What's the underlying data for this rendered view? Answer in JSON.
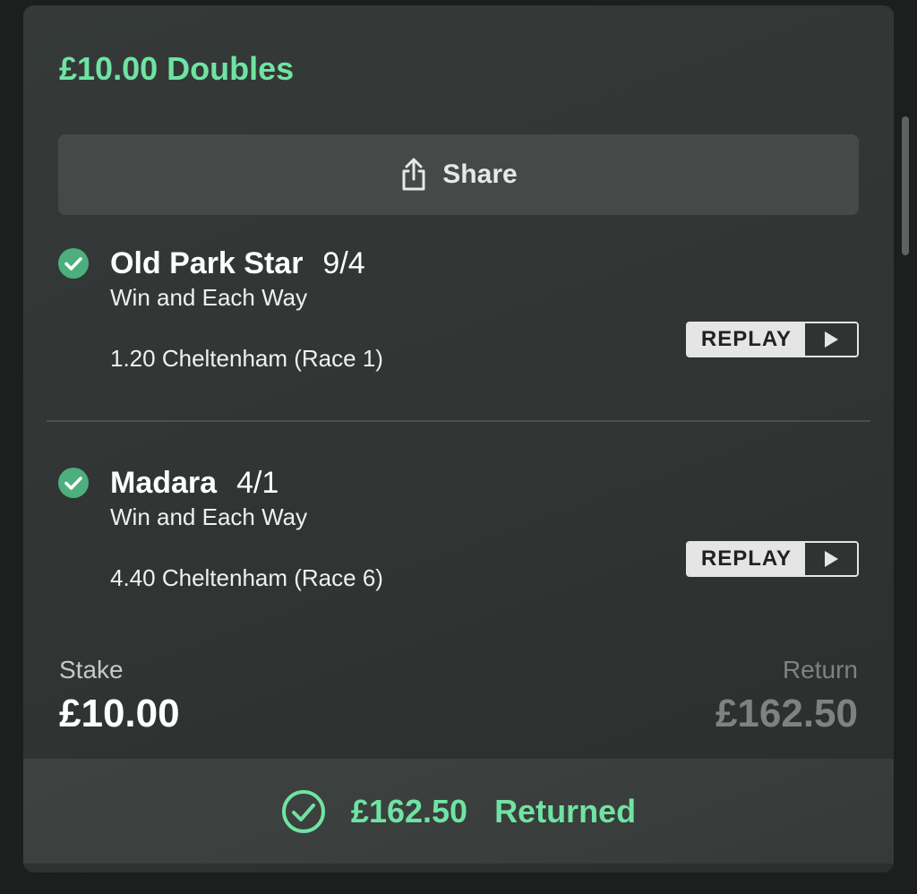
{
  "bet": {
    "title": "£10.00 Doubles",
    "share_label": "Share"
  },
  "legs": [
    {
      "selection": "Old Park Star",
      "odds": "9/4",
      "market": "Win and Each Way",
      "race": "1.20 Cheltenham (Race 1)",
      "replay_label": "REPLAY"
    },
    {
      "selection": "Madara",
      "odds": "4/1",
      "market": "Win and Each Way",
      "race": "4.40 Cheltenham (Race 6)",
      "replay_label": "REPLAY"
    }
  ],
  "summary": {
    "stake_label": "Stake",
    "stake_value": "£10.00",
    "return_label": "Return",
    "return_value": "£162.50"
  },
  "footer": {
    "returned_amount": "£162.50",
    "returned_label": "Returned"
  },
  "colors": {
    "accent_green": "#6fe3a3",
    "check_green": "#4caf7d",
    "card_bg": "#333735"
  },
  "icons": {
    "share": "share-icon",
    "leg_status": "check-circle-icon",
    "replay": "play-icon",
    "footer_status": "check-circle-outline-icon"
  }
}
